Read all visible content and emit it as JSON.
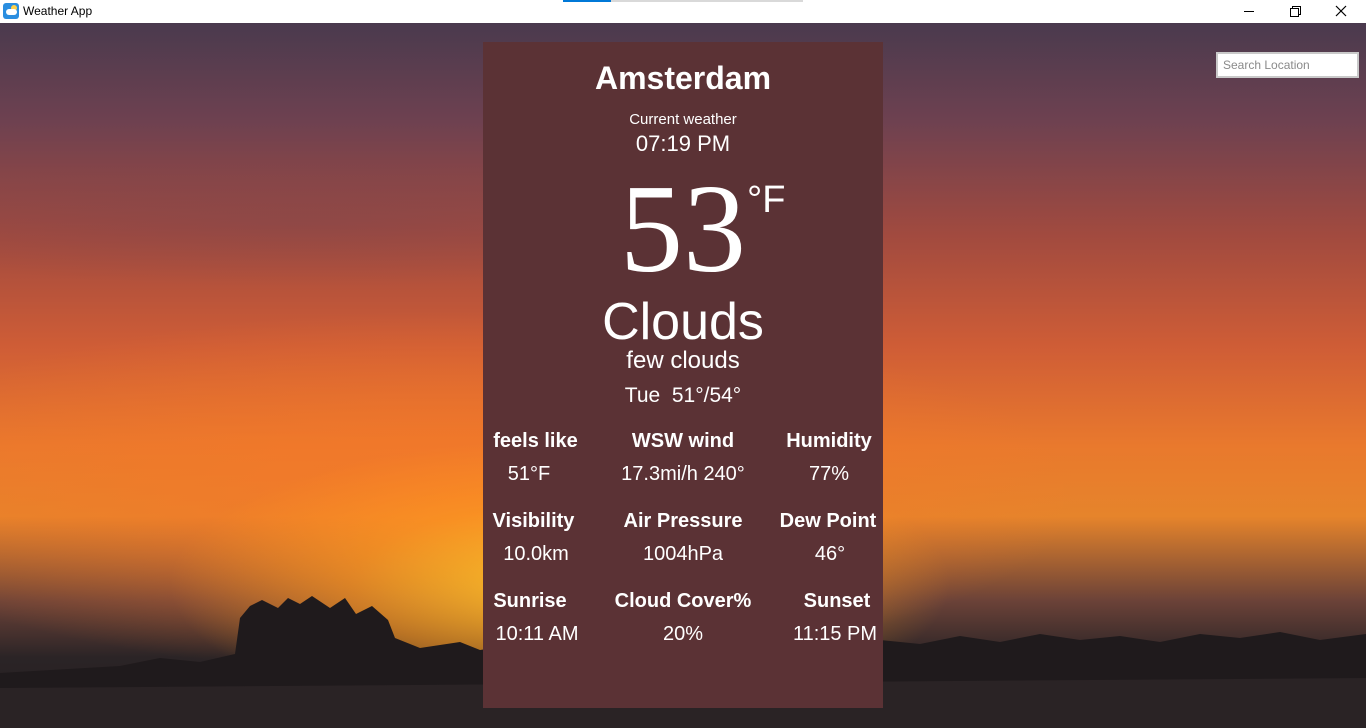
{
  "window": {
    "title": "Weather App",
    "icon": "weather-app-icon",
    "controls": [
      "minimize-icon",
      "restore-icon",
      "close-icon"
    ]
  },
  "search": {
    "placeholder": "Search Location",
    "value": ""
  },
  "weather": {
    "city": "Amsterdam",
    "label": "Current weather",
    "time": "07:19 PM",
    "temperature": "53",
    "unit": "°F",
    "condition": "Clouds",
    "description": "few clouds",
    "day_range": "Tue  51°/54°"
  },
  "stats": [
    {
      "label": "feels like",
      "value": "51°F"
    },
    {
      "label": "WSW wind",
      "value": "17.3mi/h 240°"
    },
    {
      "label": "Humidity",
      "value": "77%"
    },
    {
      "label": "Visibility",
      "value": "10.0km"
    },
    {
      "label": "Air Pressure",
      "value": "1004hPa"
    },
    {
      "label": "Dew Point",
      "value": "46°"
    },
    {
      "label": "Sunrise",
      "value": "10:11 AM"
    },
    {
      "label": "Cloud Cover%",
      "value": "20%"
    },
    {
      "label": "Sunset",
      "value": "11:15 PM"
    }
  ],
  "colors": {
    "card": "#5b3235",
    "text": "#ffffff",
    "accent": "#0078d7"
  }
}
